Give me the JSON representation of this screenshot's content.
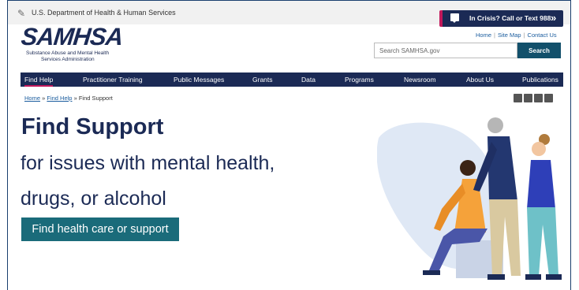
{
  "gov_banner": {
    "text": "U.S. Department of Health & Human Services"
  },
  "crisis": {
    "label": "In Crisis? Call or Text 988",
    "chevron": "»"
  },
  "logo": {
    "name": "SAMHSA",
    "subtitle_line1": "Substance Abuse and Mental Health",
    "subtitle_line2": "Services Administration"
  },
  "utility": {
    "links": [
      "Home",
      "Site Map",
      "Contact Us"
    ]
  },
  "search": {
    "placeholder": "Search SAMHSA.gov",
    "button": "Search"
  },
  "nav": {
    "items": [
      "Find Help",
      "Practitioner Training",
      "Public Messages",
      "Grants",
      "Data",
      "Programs",
      "Newsroom",
      "About Us",
      "Publications"
    ]
  },
  "breadcrumb": {
    "home": "Home",
    "sep": "»",
    "find_help": "Find Help",
    "current": "Find Support"
  },
  "share": {
    "icons": [
      "facebook-icon",
      "twitter-icon",
      "email-icon",
      "print-icon"
    ]
  },
  "hero": {
    "title": "Find Support",
    "subtitle_line1": "for issues with mental health,",
    "subtitle_line2": "drugs, or alcohol",
    "cta": "Find health care or support"
  },
  "colors": {
    "navy": "#1b2a55",
    "teal": "#1a6b7a",
    "accent": "#c2185b",
    "link": "#1a5c9e"
  }
}
